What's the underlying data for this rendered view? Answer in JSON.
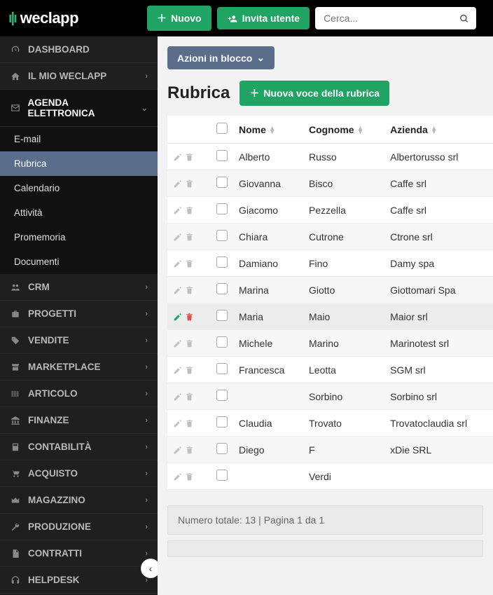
{
  "topbar": {
    "brand": "weclapp",
    "new_btn": "Nuovo",
    "invite_btn": "Invita utente",
    "search_placeholder": "Cerca..."
  },
  "sidebar": {
    "dashboard": "DASHBOARD",
    "my_weclapp": "IL MIO WECLAPP",
    "agenda": "AGENDA ELETTRONICA",
    "agenda_items": {
      "email": "E-mail",
      "rubrica": "Rubrica",
      "calendario": "Calendario",
      "attivita": "Attività",
      "promemoria": "Promemoria",
      "documenti": "Documenti"
    },
    "crm": "CRM",
    "progetti": "PROGETTI",
    "vendite": "VENDITE",
    "marketplace": "MARKETPLACE",
    "articolo": "ARTICOLO",
    "finanze": "FINANZE",
    "contabilita": "CONTABILITÀ",
    "acquisto": "ACQUISTO",
    "magazzino": "MAGAZZINO",
    "produzione": "PRODUZIONE",
    "contratti": "CONTRATTI",
    "helpdesk": "HELPDESK"
  },
  "main": {
    "bulk_btn": "Azioni in blocco",
    "title": "Rubrica",
    "new_entry_btn": "Nuova voce della rubrica",
    "columns": {
      "nome": "Nome",
      "cognome": "Cognome",
      "azienda": "Azienda"
    },
    "rows": [
      {
        "nome": "Alberto",
        "cognome": "Russo",
        "azienda": "Albertorusso srl"
      },
      {
        "nome": "Giovanna",
        "cognome": "Bisco",
        "azienda": "Caffe srl"
      },
      {
        "nome": "Giacomo",
        "cognome": "Pezzella",
        "azienda": "Caffe srl"
      },
      {
        "nome": "Chiara",
        "cognome": "Cutrone",
        "azienda": "Ctrone srl"
      },
      {
        "nome": "Damiano",
        "cognome": "Fino",
        "azienda": "Damy spa"
      },
      {
        "nome": "Marina",
        "cognome": "Giotto",
        "azienda": "Giottomari Spa"
      },
      {
        "nome": "Maria",
        "cognome": "Maio",
        "azienda": "Maior srl",
        "hover": true
      },
      {
        "nome": "Michele",
        "cognome": "Marino",
        "azienda": "Marinotest srl"
      },
      {
        "nome": "Francesca",
        "cognome": "Leotta",
        "azienda": "SGM srl"
      },
      {
        "nome": "",
        "cognome": "Sorbino",
        "azienda": "Sorbino srl"
      },
      {
        "nome": "Claudia",
        "cognome": "Trovato",
        "azienda": "Trovatoclaudia srl"
      },
      {
        "nome": "Diego",
        "cognome": "F",
        "azienda": "xDie SRL"
      },
      {
        "nome": "",
        "cognome": "Verdi",
        "azienda": ""
      }
    ],
    "footer": "Numero totale: 13 | Pagina 1 da 1"
  }
}
